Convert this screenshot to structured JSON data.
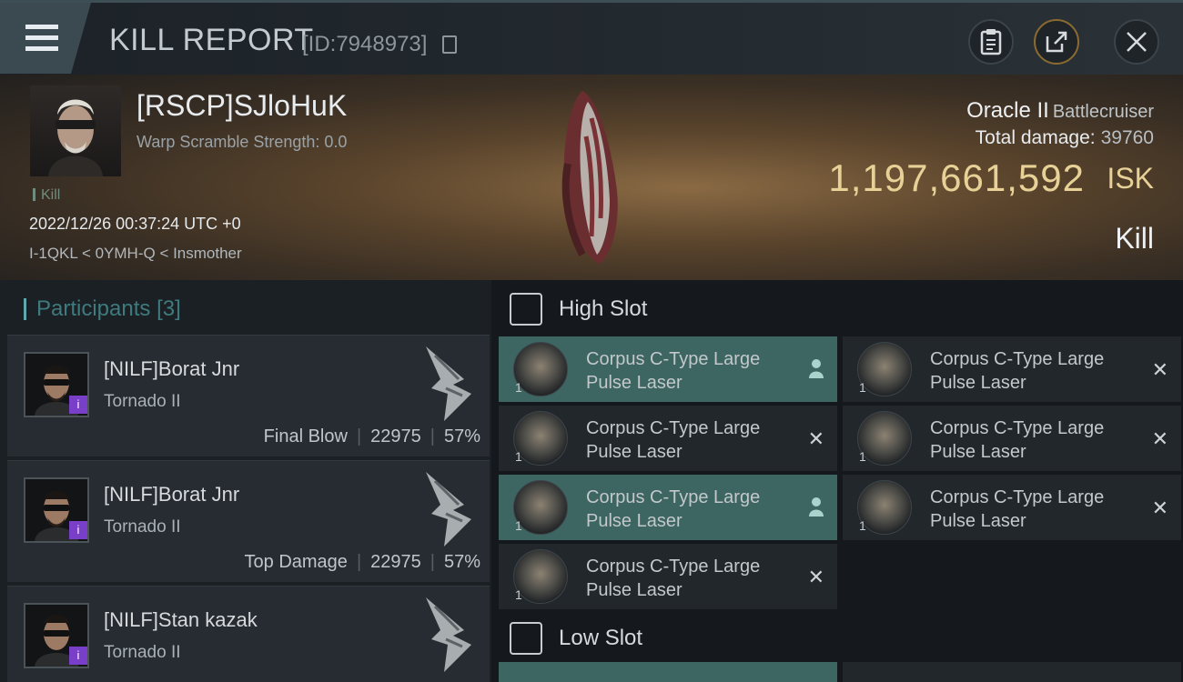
{
  "header": {
    "title": "KILL REPORT",
    "report_id": "[ID:7948973]"
  },
  "victim": {
    "name": "[RSCP]SJloHuK",
    "warp_scramble": "Warp Scramble Strength: 0.0",
    "tag": "Kill",
    "timestamp": "2022/12/26 00:37:24 UTC +0",
    "location": "I-1QKL < 0YMH-Q < Insmother"
  },
  "ship": {
    "name": "Oracle II",
    "class": "Battlecruiser",
    "total_damage_label": "Total damage:",
    "total_damage": "39760",
    "isk_value": "1,197,661,592",
    "isk_unit": "ISK",
    "result": "Kill"
  },
  "participants": {
    "title": "Participants",
    "count": "[3]",
    "items": [
      {
        "name": "[NILF]Borat Jnr",
        "ship": "Tornado II",
        "role": "Final Blow",
        "damage": "22975",
        "percent": "57%",
        "badge": "i"
      },
      {
        "name": "[NILF]Borat Jnr",
        "ship": "Tornado II",
        "role": "Top Damage",
        "damage": "22975",
        "percent": "57%",
        "badge": "i"
      },
      {
        "name": "[NILF]Stan kazak",
        "ship": "Tornado II",
        "badge": "i"
      }
    ]
  },
  "slots": {
    "high": {
      "title": "High Slot",
      "modules": [
        {
          "name_line1": "Corpus C-Type Large",
          "name_line2": "Pulse Laser",
          "qty": "1",
          "status": "dropped",
          "selected": true
        },
        {
          "name_line1": "Corpus C-Type Large",
          "name_line2": "Pulse Laser",
          "qty": "1",
          "status": "destroyed",
          "selected": false
        },
        {
          "name_line1": "Corpus C-Type Large",
          "name_line2": "Pulse Laser",
          "qty": "1",
          "status": "destroyed",
          "selected": false
        },
        {
          "name_line1": "Corpus C-Type Large",
          "name_line2": "Pulse Laser",
          "qty": "1",
          "status": "destroyed",
          "selected": false
        },
        {
          "name_line1": "Corpus C-Type Large",
          "name_line2": "Pulse Laser",
          "qty": "1",
          "status": "dropped",
          "selected": true
        },
        {
          "name_line1": "Corpus C-Type Large",
          "name_line2": "Pulse Laser",
          "qty": "1",
          "status": "destroyed",
          "selected": false
        },
        {
          "name_line1": "Corpus C-Type Large",
          "name_line2": "Pulse Laser",
          "qty": "1",
          "status": "destroyed",
          "selected": false
        }
      ]
    },
    "low": {
      "title": "Low Slot"
    }
  },
  "icons": {
    "menu": "menu-icon",
    "copy": "copy-icon",
    "clipboard": "clipboard-icon",
    "share": "share-icon",
    "close": "close-icon",
    "slot": "slot-shield-icon",
    "person": "person-icon",
    "cross": "cross-icon"
  },
  "colors": {
    "accent_teal": "#3d6561",
    "isk_gold": "#e7d196",
    "badge_purple": "#7a3fc9"
  }
}
